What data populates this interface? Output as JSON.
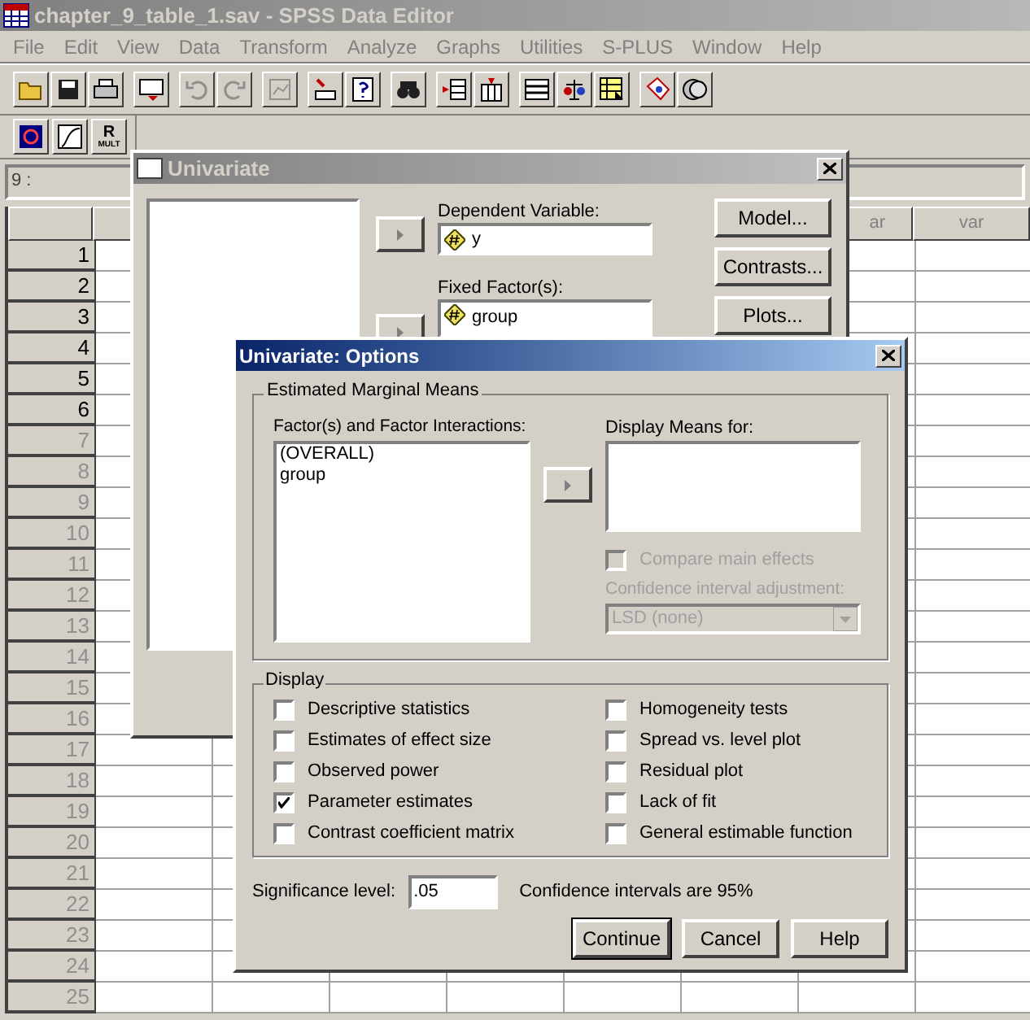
{
  "main_window": {
    "title": "chapter_9_table_1.sav - SPSS Data Editor",
    "menu": [
      "File",
      "Edit",
      "View",
      "Data",
      "Transform",
      "Analyze",
      "Graphs",
      "Utilities",
      "S-PLUS",
      "Window",
      "Help"
    ],
    "toolbar2_text_button": {
      "top": "R",
      "bottom": "MULT"
    },
    "cell_reference": "9 :",
    "column_headers": [
      "ar",
      "var"
    ],
    "rows": [
      {
        "number": "1",
        "has_data": true
      },
      {
        "number": "2",
        "has_data": true
      },
      {
        "number": "3",
        "has_data": true
      },
      {
        "number": "4",
        "has_data": true
      },
      {
        "number": "5",
        "has_data": true
      },
      {
        "number": "6",
        "has_data": true
      },
      {
        "number": "7",
        "has_data": false
      },
      {
        "number": "8",
        "has_data": false
      },
      {
        "number": "9",
        "has_data": false
      },
      {
        "number": "10",
        "has_data": false
      },
      {
        "number": "11",
        "has_data": false
      },
      {
        "number": "12",
        "has_data": false
      },
      {
        "number": "13",
        "has_data": false
      },
      {
        "number": "14",
        "has_data": false
      },
      {
        "number": "15",
        "has_data": false
      },
      {
        "number": "16",
        "has_data": false
      },
      {
        "number": "17",
        "has_data": false
      },
      {
        "number": "18",
        "has_data": false
      },
      {
        "number": "19",
        "has_data": false
      },
      {
        "number": "20",
        "has_data": false
      },
      {
        "number": "21",
        "has_data": false
      },
      {
        "number": "22",
        "has_data": false
      },
      {
        "number": "23",
        "has_data": false
      },
      {
        "number": "24",
        "has_data": false
      },
      {
        "number": "25",
        "has_data": false
      }
    ]
  },
  "univariate_dialog": {
    "title": "Univariate",
    "dependent_label": "Dependent Variable:",
    "dependent_value": "y",
    "fixed_factors_label": "Fixed Factor(s):",
    "fixed_factors_value": "group",
    "buttons": [
      "Model...",
      "Contrasts...",
      "Plots..."
    ]
  },
  "options_dialog": {
    "title": "Univariate: Options",
    "emm_group": "Estimated Marginal Means",
    "factors_label": "Factor(s) and Factor Interactions:",
    "factors": [
      "(OVERALL)",
      "group"
    ],
    "display_means_label": "Display Means for:",
    "compare_main_effects": {
      "label": "Compare main effects",
      "checked": false,
      "disabled": true
    },
    "ci_adjustment": {
      "label": "Confidence interval adjustment:",
      "value": "LSD (none)",
      "disabled": true
    },
    "display_group": "Display",
    "display_left": [
      {
        "label": "Descriptive statistics",
        "checked": false
      },
      {
        "label": "Estimates of effect size",
        "checked": false
      },
      {
        "label": "Observed power",
        "checked": false
      },
      {
        "label": "Parameter estimates",
        "checked": true
      },
      {
        "label": "Contrast coefficient matrix",
        "checked": false
      }
    ],
    "display_right": [
      {
        "label": "Homogeneity tests",
        "checked": false
      },
      {
        "label": "Spread vs. level plot",
        "checked": false
      },
      {
        "label": "Residual plot",
        "checked": false
      },
      {
        "label": "Lack of fit",
        "checked": false
      },
      {
        "label": "General estimable function",
        "checked": false
      }
    ],
    "significance_label": "Significance level:",
    "significance_value": ".05",
    "ci_text": "Confidence intervals are 95%",
    "buttons": [
      {
        "label": "Continue",
        "default": true
      },
      {
        "label": "Cancel",
        "default": false
      },
      {
        "label": "Help",
        "default": false
      }
    ]
  }
}
